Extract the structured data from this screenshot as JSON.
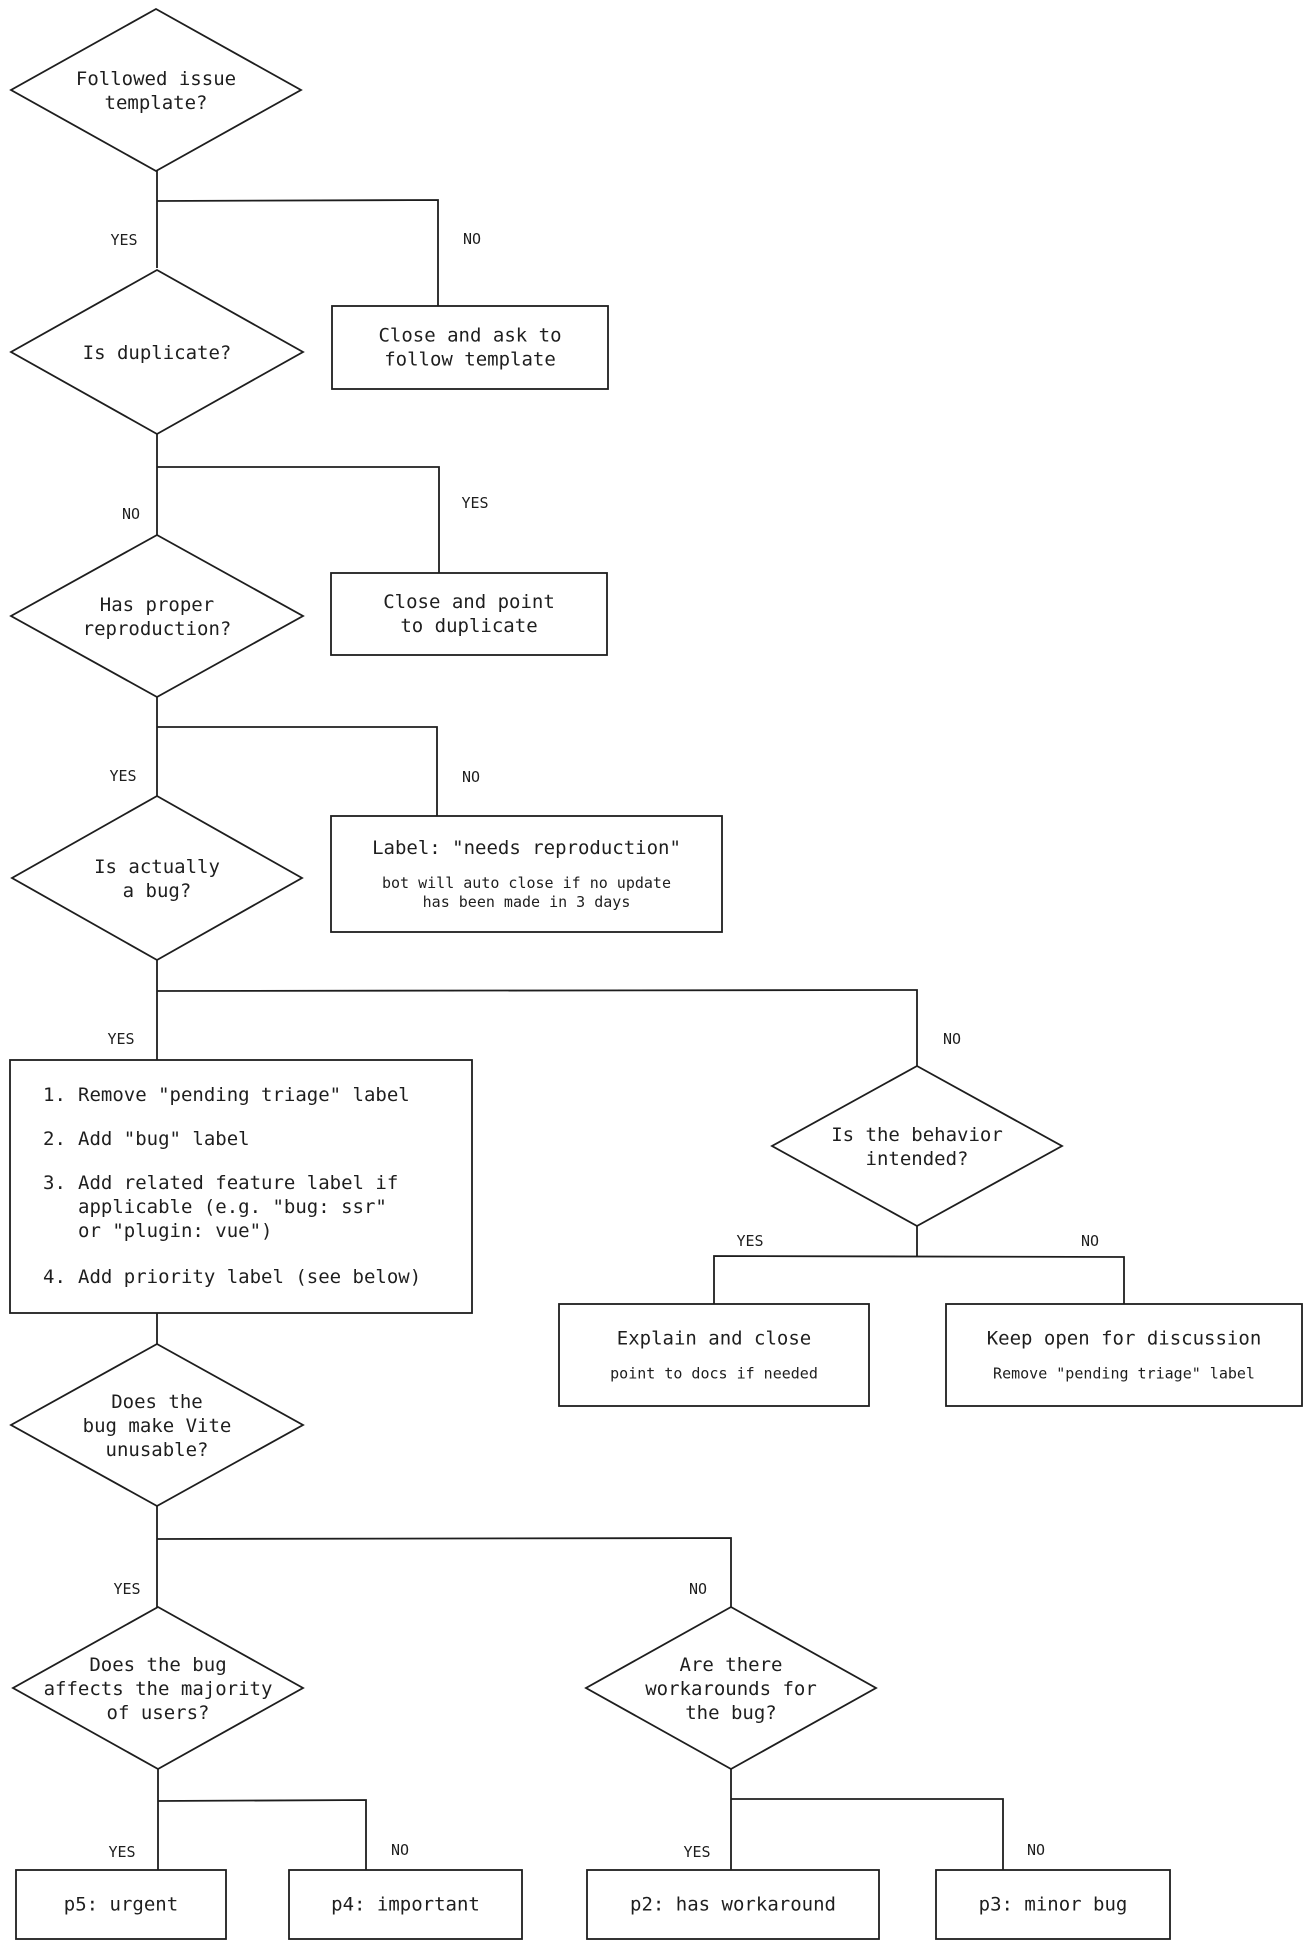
{
  "diagram": {
    "decisions": [
      {
        "id": "followed-template",
        "lines": [
          "Followed issue",
          "template?"
        ]
      },
      {
        "id": "is-duplicate",
        "lines": [
          "Is duplicate?"
        ]
      },
      {
        "id": "has-reproduction",
        "lines": [
          "Has proper",
          "reproduction?"
        ]
      },
      {
        "id": "is-bug",
        "lines": [
          "Is actually",
          "a bug?"
        ]
      },
      {
        "id": "behavior-intended",
        "lines": [
          "Is the behavior",
          "intended?"
        ]
      },
      {
        "id": "vite-unusable",
        "lines": [
          "Does the",
          "bug make Vite",
          "unusable?"
        ]
      },
      {
        "id": "affects-majority",
        "lines": [
          "Does the bug",
          "affects the majority",
          "of users?"
        ]
      },
      {
        "id": "has-workarounds",
        "lines": [
          "Are there",
          "workarounds for",
          "the bug?"
        ]
      }
    ],
    "actions": [
      {
        "id": "close-follow-template",
        "title": [
          "Close and ask to",
          "follow template"
        ],
        "sub": []
      },
      {
        "id": "close-duplicate",
        "title": [
          "Close and point",
          "to duplicate"
        ],
        "sub": []
      },
      {
        "id": "needs-reproduction",
        "title": [
          "Label: \"needs reproduction\""
        ],
        "sub": [
          "bot will auto close if no update",
          "has been made in 3 days"
        ]
      },
      {
        "id": "explain-close",
        "title": [
          "Explain and close"
        ],
        "sub": [
          "point to docs if needed"
        ]
      },
      {
        "id": "keep-open",
        "title": [
          "Keep open for discussion"
        ],
        "sub": [
          "Remove \"pending triage\" label"
        ]
      },
      {
        "id": "p5",
        "title": [
          "p5: urgent"
        ],
        "sub": []
      },
      {
        "id": "p4",
        "title": [
          "p4: important"
        ],
        "sub": []
      },
      {
        "id": "p2",
        "title": [
          "p2: has workaround"
        ],
        "sub": []
      },
      {
        "id": "p3",
        "title": [
          "p3: minor bug"
        ],
        "sub": []
      }
    ],
    "bug_steps": [
      {
        "num": "1.",
        "lines": [
          "Remove \"pending triage\" label"
        ]
      },
      {
        "num": "2.",
        "lines": [
          "Add \"bug\" label"
        ]
      },
      {
        "num": "3.",
        "lines": [
          "Add related feature label if",
          "applicable (e.g. \"bug: ssr\"",
          "or \"plugin: vue\")"
        ]
      },
      {
        "num": "4.",
        "lines": [
          "Add priority label (see below)"
        ]
      }
    ],
    "edge_labels": [
      {
        "id": "e1-yes",
        "text": "YES"
      },
      {
        "id": "e1-no",
        "text": "NO"
      },
      {
        "id": "e2-no",
        "text": "NO"
      },
      {
        "id": "e2-yes",
        "text": "YES"
      },
      {
        "id": "e3-yes",
        "text": "YES"
      },
      {
        "id": "e3-no",
        "text": "NO"
      },
      {
        "id": "e4-yes",
        "text": "YES"
      },
      {
        "id": "e4-no",
        "text": "NO"
      },
      {
        "id": "e5-yes",
        "text": "YES"
      },
      {
        "id": "e5-no",
        "text": "NO"
      },
      {
        "id": "e6-yes",
        "text": "YES"
      },
      {
        "id": "e6-no",
        "text": "NO"
      },
      {
        "id": "e7-yes",
        "text": "YES"
      },
      {
        "id": "e7-no",
        "text": "NO"
      },
      {
        "id": "e8-yes",
        "text": "YES"
      },
      {
        "id": "e8-no",
        "text": "NO"
      }
    ]
  }
}
